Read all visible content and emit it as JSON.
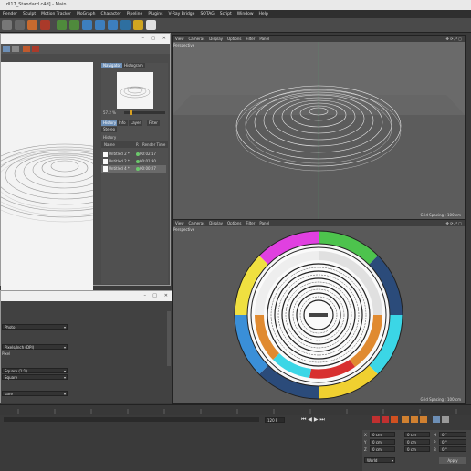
{
  "window_title": "...dl17_Standard.c4d] - Main",
  "menus": [
    "Render",
    "Sculpt",
    "Motion Tracker",
    "MoGraph",
    "Character",
    "Pipeline",
    "Plugins",
    "V-Ray Bridge",
    "SOTAG",
    "Script",
    "Window",
    "Help"
  ],
  "picture_viewer": {
    "tabs": [
      "Navigator",
      "Histogram"
    ],
    "zoom": "57.2 %",
    "info_tabs": [
      "History",
      "Info",
      "Layer",
      "Filter",
      "Stereo"
    ],
    "history_header": "History",
    "columns": [
      "Name",
      "R",
      "Render Time"
    ],
    "rows": [
      {
        "name": "Untitled 2 *",
        "time": "00:02:17"
      },
      {
        "name": "Untitled 2 *",
        "time": "00:01:30"
      },
      {
        "name": "Untitled 4 *",
        "time": "00:00:27"
      }
    ]
  },
  "attributes": {
    "fields": [
      "Photo",
      "Pixels/Inch (DPI)",
      "Square (1:1)",
      "Square"
    ],
    "labels": [
      "Pixel"
    ],
    "fields_short": [
      "uare"
    ]
  },
  "viewports": {
    "menu": [
      "View",
      "Cameras",
      "Display",
      "Options",
      "Filter",
      "Panel"
    ],
    "label": "Perspective",
    "grid_spacing": "Grid Spacing : 100 cm"
  },
  "timeline": {
    "frame_field": "120 F"
  },
  "coords": {
    "rows": [
      {
        "axis": "X",
        "value": "0 cm"
      },
      {
        "axis": "Y",
        "value": "0 cm"
      },
      {
        "axis": "Z",
        "value": "0 cm"
      }
    ],
    "rows2": [
      "0 cm",
      "0 cm",
      "0 cm"
    ],
    "rows3": [
      {
        "axis": "H",
        "value": "0 °"
      },
      {
        "axis": "P",
        "value": "0 °"
      },
      {
        "axis": "B",
        "value": "0 °"
      }
    ],
    "mode": "World",
    "apply": "Apply"
  },
  "colors": {
    "accent": "#6d8fb6"
  }
}
